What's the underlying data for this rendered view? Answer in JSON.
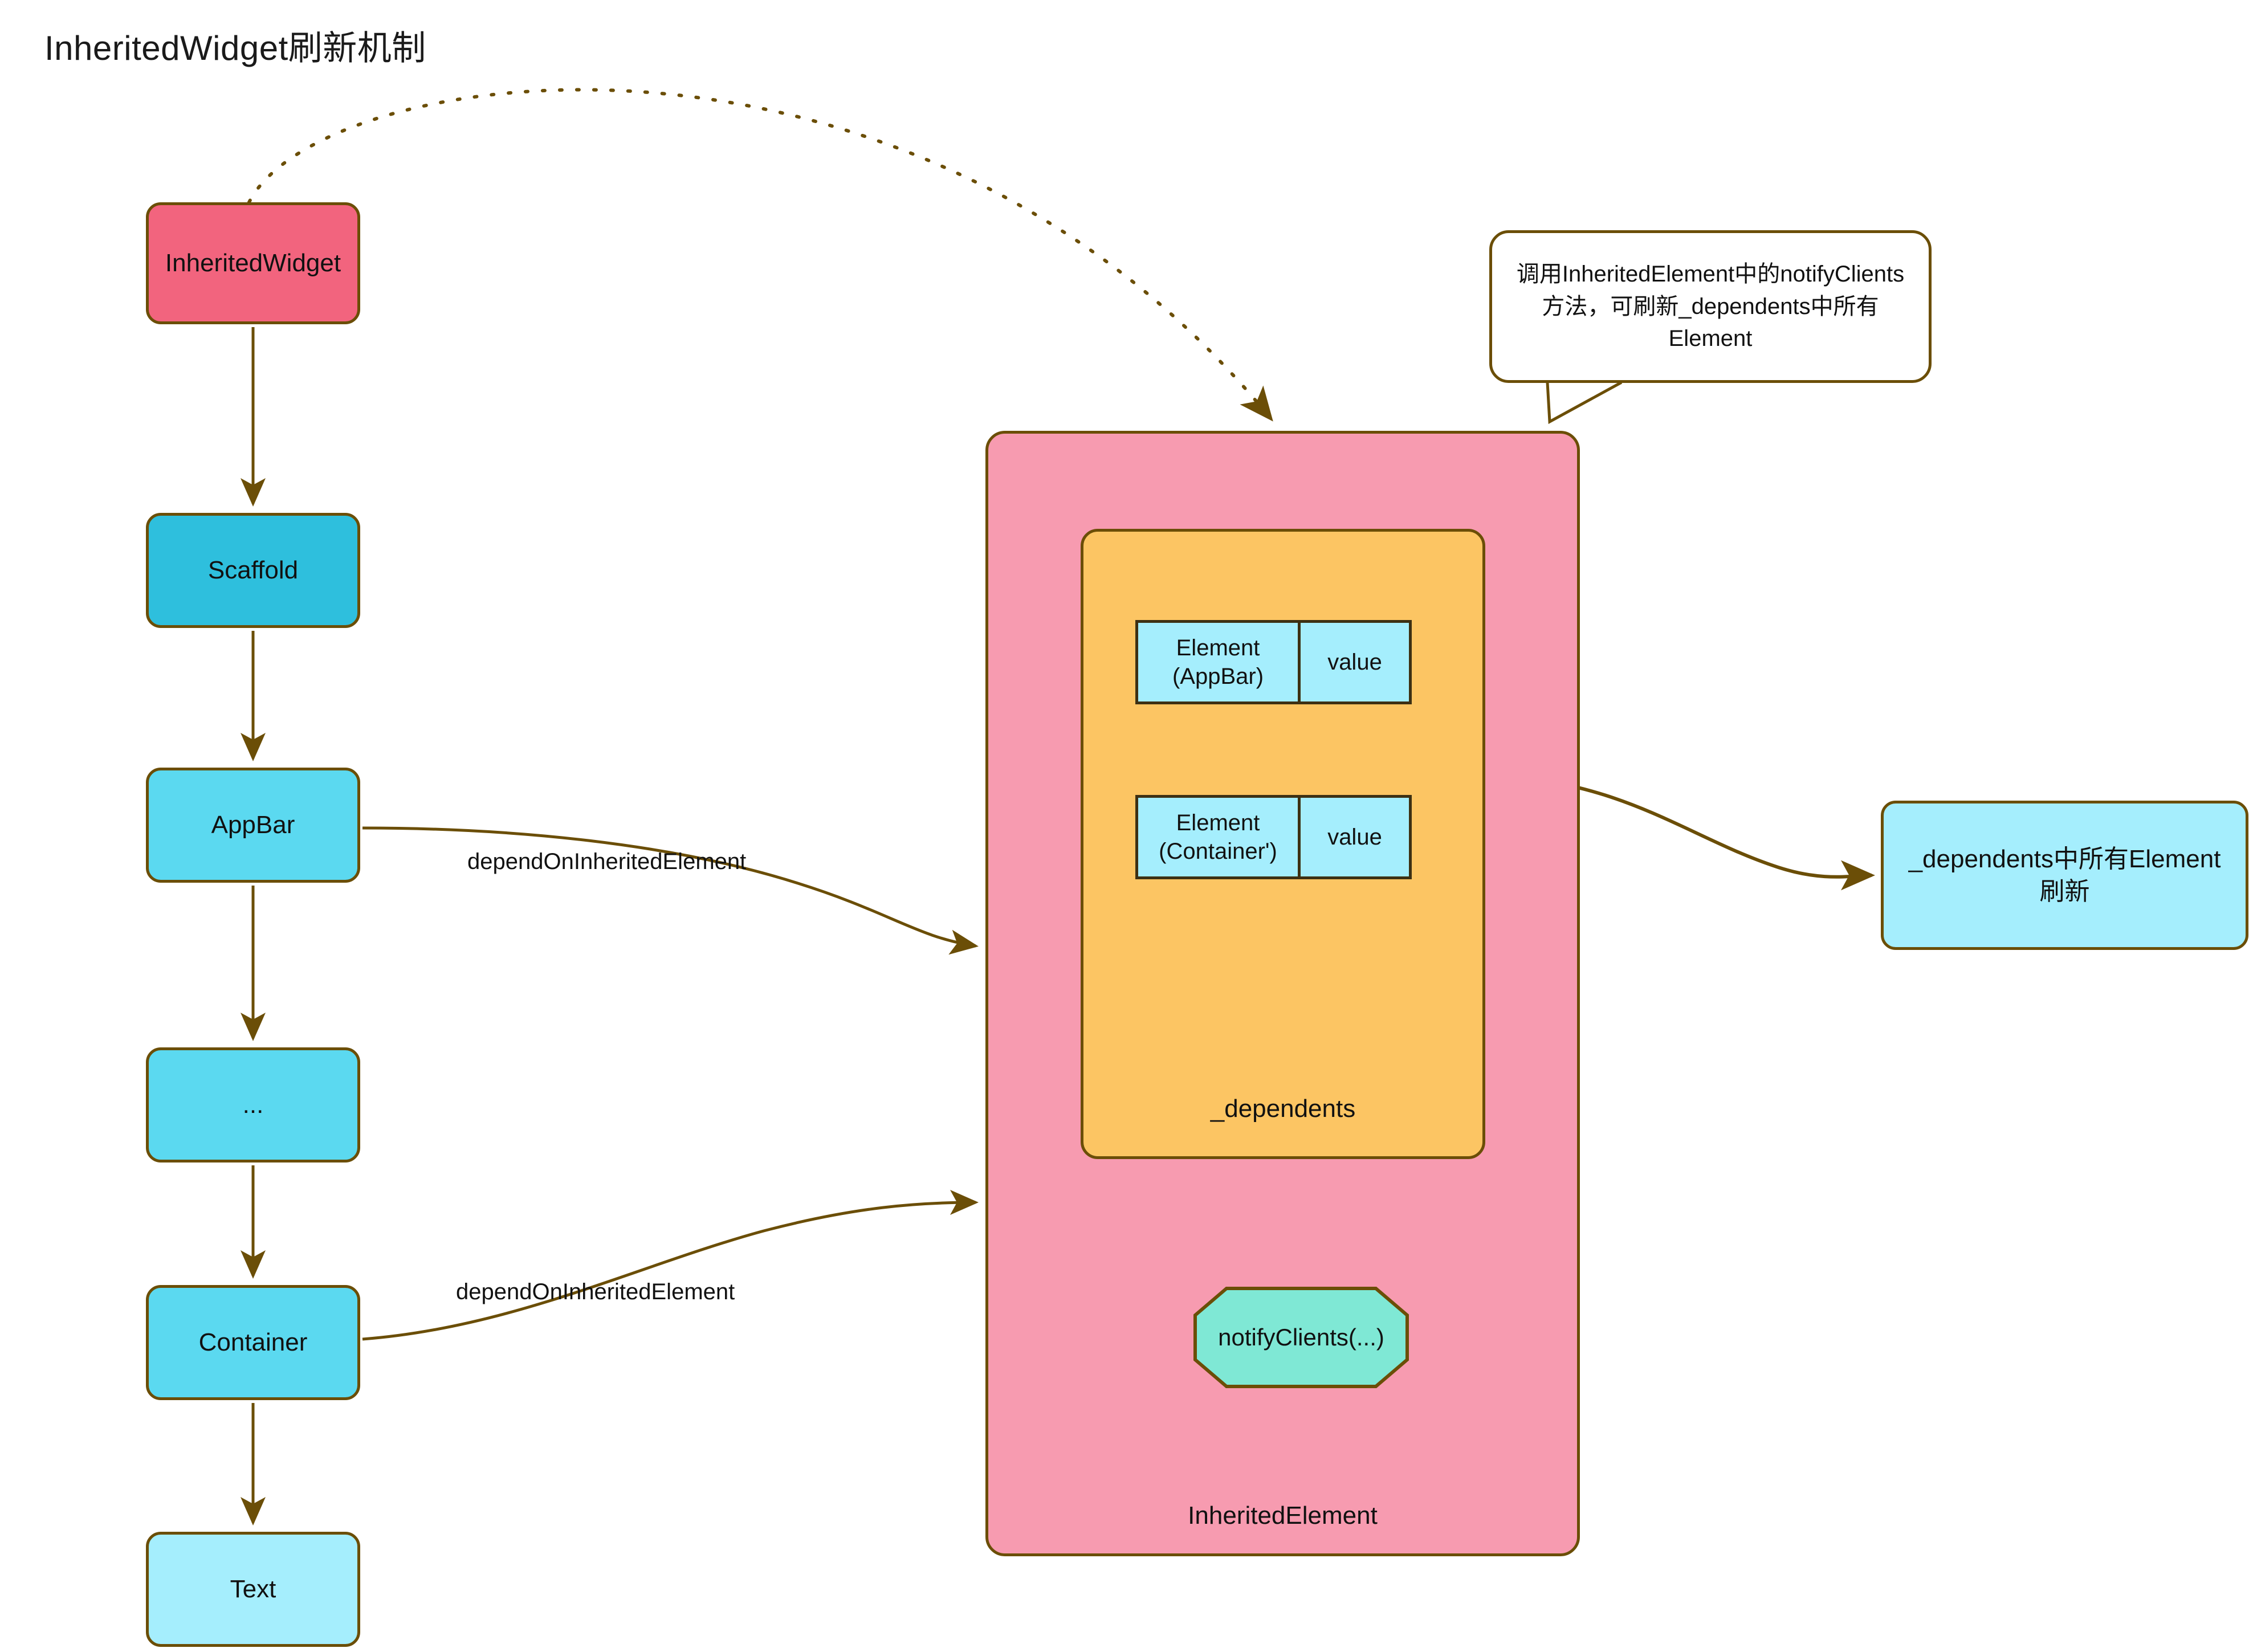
{
  "page": {
    "title": "InheritedWidget刷新机制"
  },
  "widget_chain": {
    "nodes": [
      {
        "label": "InheritedWidget",
        "color": "#f2647e"
      },
      {
        "label": "Scaffold",
        "color": "#2ebfdd"
      },
      {
        "label": "AppBar",
        "color": "#5bd9f0"
      },
      {
        "label": "...",
        "color": "#5bd9f0"
      },
      {
        "label": "Container",
        "color": "#5bd9f0"
      },
      {
        "label": "Text",
        "color": "#a5eefd"
      }
    ]
  },
  "inherited_element": {
    "label": "InheritedElement",
    "color": "#f79bb0",
    "dependents": {
      "label": "_dependents",
      "color": "#fcc563",
      "rows": [
        {
          "element": "Element\n(AppBar)",
          "element_line1": "Element",
          "element_line2": "(AppBar)",
          "value": "value"
        },
        {
          "element": "Element\n(Container')",
          "element_line1": "Element",
          "element_line2": "(Container')",
          "value": "value"
        }
      ]
    },
    "notify_clients": {
      "label": "notifyClients(...)",
      "color": "#7fe8d5"
    }
  },
  "result_box": {
    "label": "_dependents中所有Element刷新",
    "color": "#a5eefd"
  },
  "callout": {
    "text": "调用InheritedElement中的notifyClients方法，可刷新_dependents中所有Element"
  },
  "edges": {
    "appbar_depend_label": "dependOnInheritedElement",
    "container_depend_label": "dependOnInheritedElement",
    "stroke_color": "#6b4e07"
  }
}
